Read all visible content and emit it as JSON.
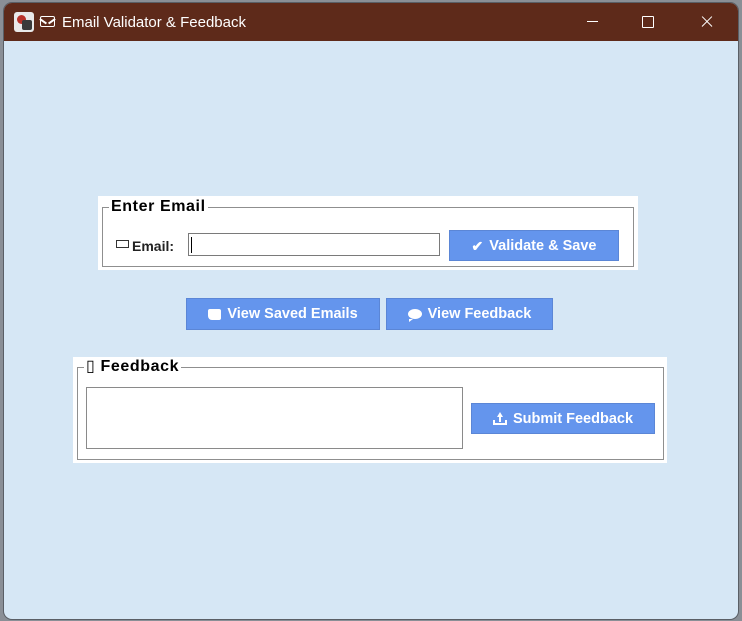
{
  "window": {
    "title": "Email Validator & Feedback",
    "title_icon": "envelope-icon",
    "controls": [
      "minimize-icon",
      "maximize-icon",
      "close-icon"
    ],
    "background": "#d6e7f5",
    "titlebar_color": "#5e2a1a"
  },
  "email_section": {
    "legend": "Enter Email",
    "label": "Email:",
    "label_icon": "envelope-icon",
    "input_value": "",
    "validate_button": {
      "icon": "check-icon",
      "icon_glyph": "✔",
      "label": "Validate & Save"
    }
  },
  "actions": {
    "view_saved": {
      "icon": "scroll-icon",
      "label": "View Saved Emails"
    },
    "view_feedback": {
      "icon": "speech-bubble-icon",
      "label": "View Feedback"
    }
  },
  "feedback_section": {
    "legend": "Feedback",
    "legend_icon_glyph": "▯",
    "textarea_value": "",
    "submit_button": {
      "icon": "upload-icon",
      "label": "Submit Feedback"
    }
  },
  "colors": {
    "button": "#6495ed",
    "panel": "#ffffff"
  }
}
